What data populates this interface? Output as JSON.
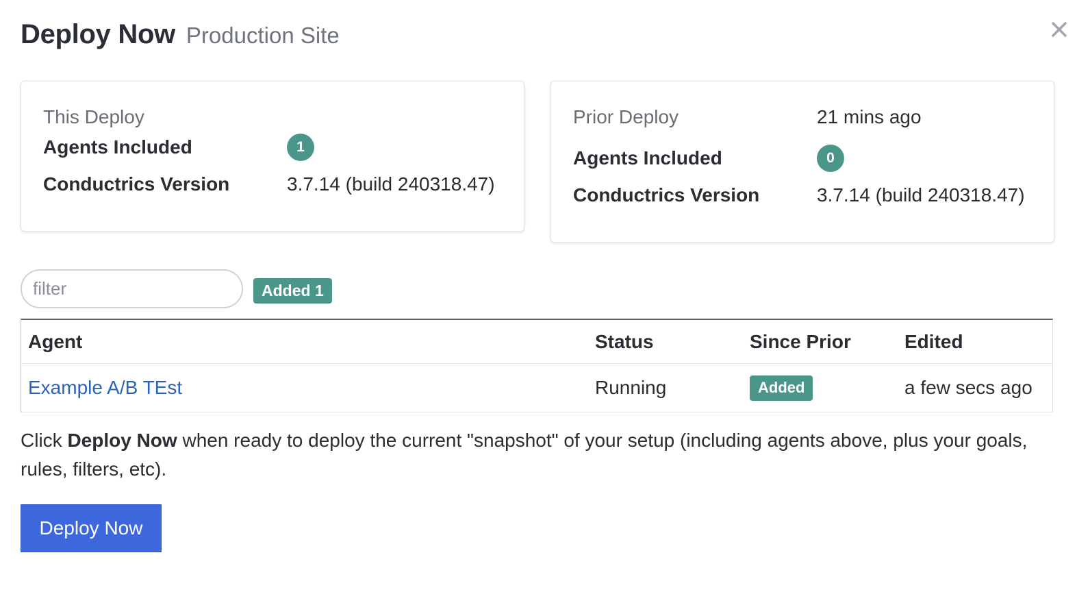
{
  "header": {
    "title": "Deploy Now",
    "subtitle": "Production Site",
    "close_icon": "close-icon"
  },
  "this_deploy": {
    "heading": "This Deploy",
    "agents_label": "Agents Included",
    "agents_count": "1",
    "version_label": "Conductrics Version",
    "version_value": "3.7.14 (build 240318.47)"
  },
  "prior_deploy": {
    "heading": "Prior Deploy",
    "time_ago": "21 mins ago",
    "agents_label": "Agents Included",
    "agents_count": "0",
    "version_label": "Conductrics Version",
    "version_value": "3.7.14 (build 240318.47)"
  },
  "filter": {
    "placeholder": "filter",
    "value": "",
    "chip_label": "Added 1"
  },
  "table": {
    "columns": [
      "Agent",
      "Status",
      "Since Prior",
      "Edited"
    ],
    "rows": [
      {
        "agent": "Example A/B TEst",
        "status": "Running",
        "since_prior": "Added",
        "edited": "a few secs ago"
      }
    ]
  },
  "description": {
    "prefix": "Click ",
    "bold": "Deploy Now",
    "suffix": " when ready to deploy the current \"snapshot\" of your setup (including agents above, plus your goals, rules, filters, etc)."
  },
  "deploy_button": {
    "label": "Deploy Now"
  },
  "colors": {
    "accent_teal": "#4a9688",
    "primary_blue": "#3d68dd",
    "link_blue": "#2d63b4"
  }
}
